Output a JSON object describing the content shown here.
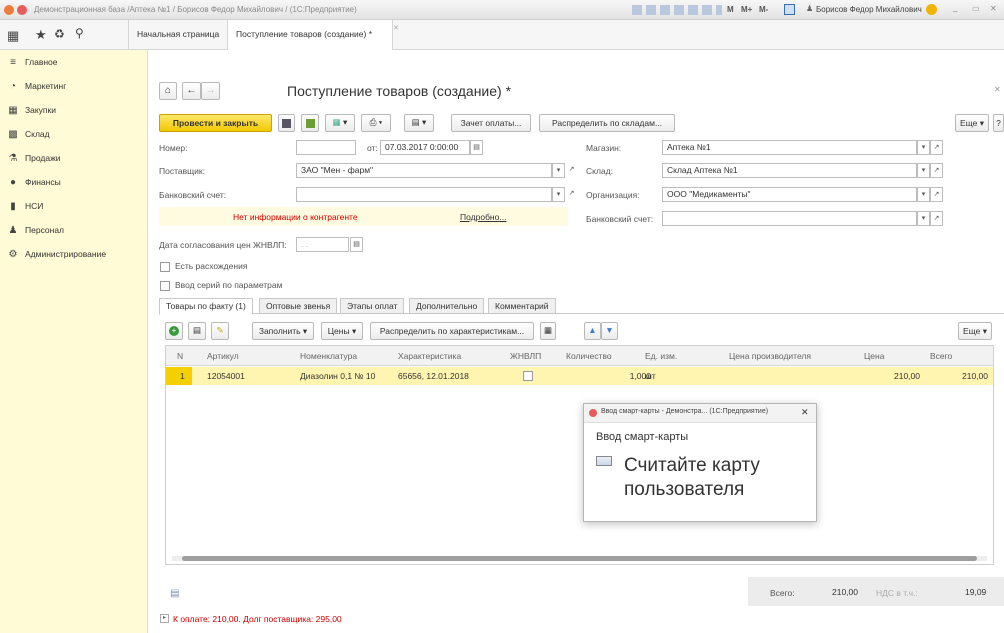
{
  "window": {
    "title": "Демонстрационная база /Аптека №1 / Борисов Федор Михайлович / (1С:Предприятие)",
    "calc_buttons": [
      "M",
      "M+",
      "M-"
    ],
    "user": "Борисов Федор Михайлович"
  },
  "nav": {
    "tabs": [
      "Начальная страница",
      "Поступление товаров (создание) *"
    ]
  },
  "sidebar": {
    "items": [
      {
        "label": "Главное",
        "icon": "menu-icon"
      },
      {
        "label": "Маркетинг",
        "icon": "marketing-icon"
      },
      {
        "label": "Закупки",
        "icon": "purchases-icon"
      },
      {
        "label": "Склад",
        "icon": "warehouse-icon"
      },
      {
        "label": "Продажи",
        "icon": "sales-icon"
      },
      {
        "label": "Финансы",
        "icon": "finance-icon"
      },
      {
        "label": "НСИ",
        "icon": "reference-icon"
      },
      {
        "label": "Персонал",
        "icon": "person-icon"
      },
      {
        "label": "Администрирование",
        "icon": "gear-icon"
      }
    ]
  },
  "form": {
    "title": "Поступление товаров (создание) *",
    "toolbar": {
      "post_close": "Провести и закрыть",
      "payment_offset": "Зачет оплаты...",
      "distribute_warehouses": "Распределить по складам...",
      "more": "Еще",
      "help": "?"
    },
    "fields": {
      "number_label": "Номер:",
      "number_value": "",
      "date_from_label": "от:",
      "date_value": "07.03.2017  0:00:00",
      "supplier_label": "Поставщик:",
      "supplier_value": "ЗАО \"Мен - фарм\"",
      "bank_account_label": "Банковский счет:",
      "bank_account_value": "",
      "shop_label": "Магазин:",
      "shop_value": "Аптека №1",
      "warehouse_label": "Склад:",
      "warehouse_value": "Склад Аптека №1",
      "organization_label": "Организация:",
      "organization_value": "ООО \"Медикаменты\"",
      "bank_account2_label": "Банковский счет:",
      "bank_account2_value": "",
      "no_info_warning": "Нет информации о контрагенте",
      "details_link": "Подробно...",
      "price_approval_label": "Дата согласования цен ЖНВЛП:",
      "price_approval_value": ". .",
      "discrepancies_label": "Есть расхождения",
      "series_input_label": "Ввод серий по параметрам"
    },
    "tabs": [
      "Товары по факту (1)",
      "Оптовые звенья",
      "Этапы оплат",
      "Дополнительно",
      "Комментарий"
    ],
    "table_toolbar": {
      "fill": "Заполнить",
      "prices": "Цены",
      "distribute_chars": "Распределить по характеристикам...",
      "more": "Еще"
    },
    "table": {
      "columns": [
        "N",
        "Артикул",
        "Номенклатура",
        "Характеристика",
        "ЖНВЛП",
        "Количество",
        "Ед. изм.",
        "Цена производителя",
        "Цена",
        "Всего"
      ],
      "rows": [
        {
          "n": "1",
          "article": "12054001",
          "item": "Диазолин 0,1 № 10",
          "characteristic": "65656, 12.01.2018",
          "vital": false,
          "qty": "1,000",
          "unit": "шт",
          "mfr_price": "",
          "price": "210,00",
          "total": "210,00"
        }
      ]
    },
    "totals": {
      "total_label": "Всего:",
      "total_value": "210,00",
      "vat_label": "НДС в т.ч.:",
      "vat_value": "19,09"
    },
    "payment_note": "К оплате: 210,00. Долг поставщика: 295,00"
  },
  "dialog": {
    "title": "Ввод смарт-карты - Демонстра... (1С:Предприятие)",
    "heading": "Ввод смарт-карты",
    "message": "Считайте карту пользователя"
  },
  "colors": {
    "accent_yellow": "#f4d000",
    "sidebar_bg": "#fffbd6",
    "warning_red": "#d00000",
    "row_highlight": "#fff4b0"
  }
}
